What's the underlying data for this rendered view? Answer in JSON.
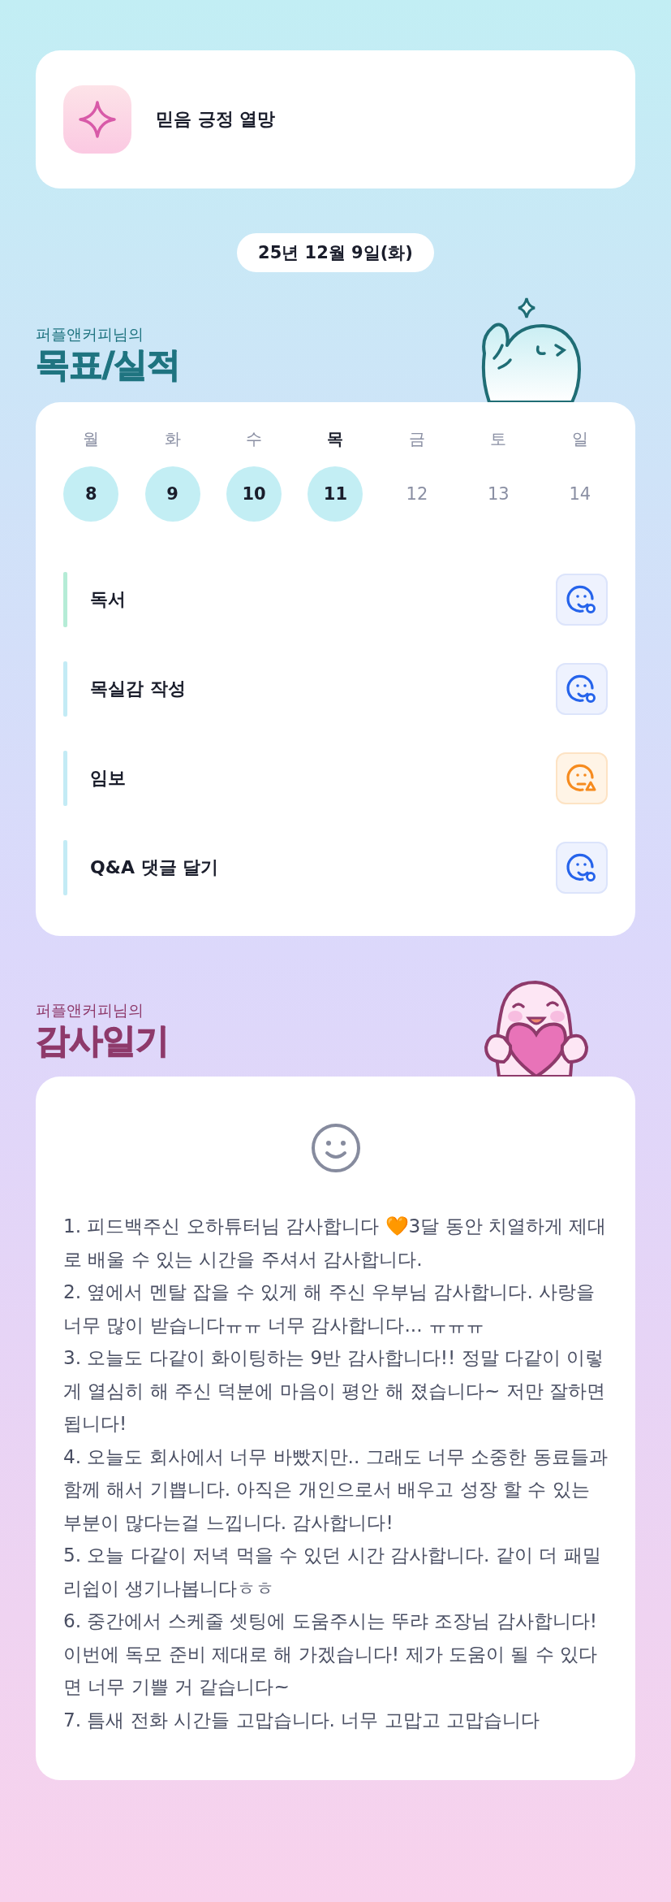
{
  "motto": {
    "text": "믿음 긍정 열망"
  },
  "date": "25년 12월 9일(화)",
  "goals_section": {
    "owner": "퍼플앤커피님의",
    "title": "목표/실적"
  },
  "week": [
    {
      "day": "월",
      "date": "8",
      "done": true,
      "selected": false
    },
    {
      "day": "화",
      "date": "9",
      "done": true,
      "selected": false
    },
    {
      "day": "수",
      "date": "10",
      "done": true,
      "selected": false
    },
    {
      "day": "목",
      "date": "11",
      "done": true,
      "selected": true
    },
    {
      "day": "금",
      "date": "12",
      "done": false,
      "selected": false
    },
    {
      "day": "토",
      "date": "13",
      "done": false,
      "selected": false
    },
    {
      "day": "일",
      "date": "14",
      "done": false,
      "selected": false
    }
  ],
  "tasks": [
    {
      "label": "독서",
      "color": "#b5ecd6",
      "kind": "good"
    },
    {
      "label": "목실감 작성",
      "color": "#c3ebf5",
      "kind": "good"
    },
    {
      "label": "임보",
      "color": "#c3ebf5",
      "kind": "warning"
    },
    {
      "label": "Q&A 댓글 달기",
      "color": "#c3ebf5",
      "kind": "good"
    }
  ],
  "diary_section": {
    "owner": "퍼플앤커피님의",
    "title": "감사일기"
  },
  "diary": {
    "entries": [
      "1. 피드백주신 오하튜터님 감사합니다  🧡3달 동안 치열하게 제대로 배울 수 있는 시간을 주셔서 감사합니다.",
      "2. 옆에서 멘탈 잡을 수 있게 해 주신 우부님 감사합니다. 사랑을 너무 많이 받습니다ㅠㅠ 너무 감사합니다... ㅠㅠㅠ",
      "3. 오늘도 다같이 화이팅하는 9반 감사합니다!! 정말 다같이 이렇게 열심히 해 주신 덕분에 마음이 평안 해 졌습니다~ 저만 잘하면 됩니다!",
      "4. 오늘도 회사에서 너무 바빴지만.. 그래도 너무 소중한 동료들과 함께 해서 기쁩니다. 아직은 개인으로서 배우고 성장 할 수 있는 부분이 많다는걸 느낍니다. 감사합니다!",
      "5. 오늘 다같이 저녁 먹을 수 있던 시간 감사합니다. 같이 더 패밀리쉽이 생기나봅니다ㅎㅎ",
      "6. 중간에서 스케줄 셋팅에 도움주시는 뚜랴 조장님 감사합니다! 이번에 독모 준비 제대로 해 가겠습니다! 제가 도움이 될 수 있다면 너무 기쁠 거 같습니다~",
      "7. 틈새 전화 시간들 고맙습니다. 너무 고맙고 고맙습니다"
    ]
  }
}
